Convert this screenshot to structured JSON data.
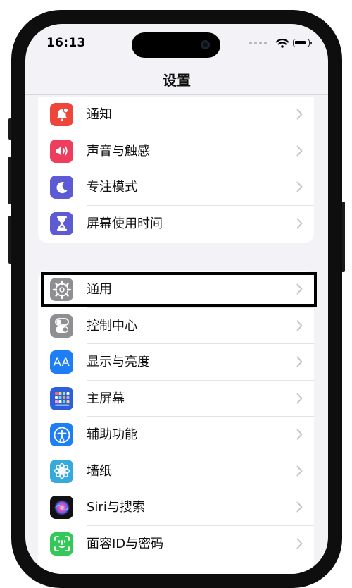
{
  "status": {
    "time": "16:13"
  },
  "nav": {
    "title": "设置"
  },
  "group1": [
    {
      "label": "通知",
      "icon": "bell-badge-icon",
      "color": "#f0453a"
    },
    {
      "label": "声音与触感",
      "icon": "speaker-icon",
      "color": "#ee3d5d"
    },
    {
      "label": "专注模式",
      "icon": "moon-icon",
      "color": "#5d5ad6"
    },
    {
      "label": "屏幕使用时间",
      "icon": "hourglass-icon",
      "color": "#5d5ad6"
    }
  ],
  "group2": [
    {
      "label": "通用",
      "icon": "gear-icon",
      "color": "#8e8e93",
      "highlighted": true
    },
    {
      "label": "控制中心",
      "icon": "toggle-icon",
      "color": "#8e8e93"
    },
    {
      "label": "显示与亮度",
      "icon": "aa-text-icon",
      "color": "#1d7ef5",
      "icon_text": "AA"
    },
    {
      "label": "主屏幕",
      "icon": "home-grid-icon",
      "color": "#2d5fd9"
    },
    {
      "label": "辅助功能",
      "icon": "accessibility-icon",
      "color": "#1d7ef5"
    },
    {
      "label": "墙纸",
      "icon": "flower-icon",
      "color": "#37aadc"
    },
    {
      "label": "Siri与搜索",
      "icon": "siri-icon",
      "color": "#111111"
    },
    {
      "label": "面容ID与密码",
      "icon": "face-id-icon",
      "color": "#34c759"
    }
  ],
  "highlight_color": "#000000"
}
